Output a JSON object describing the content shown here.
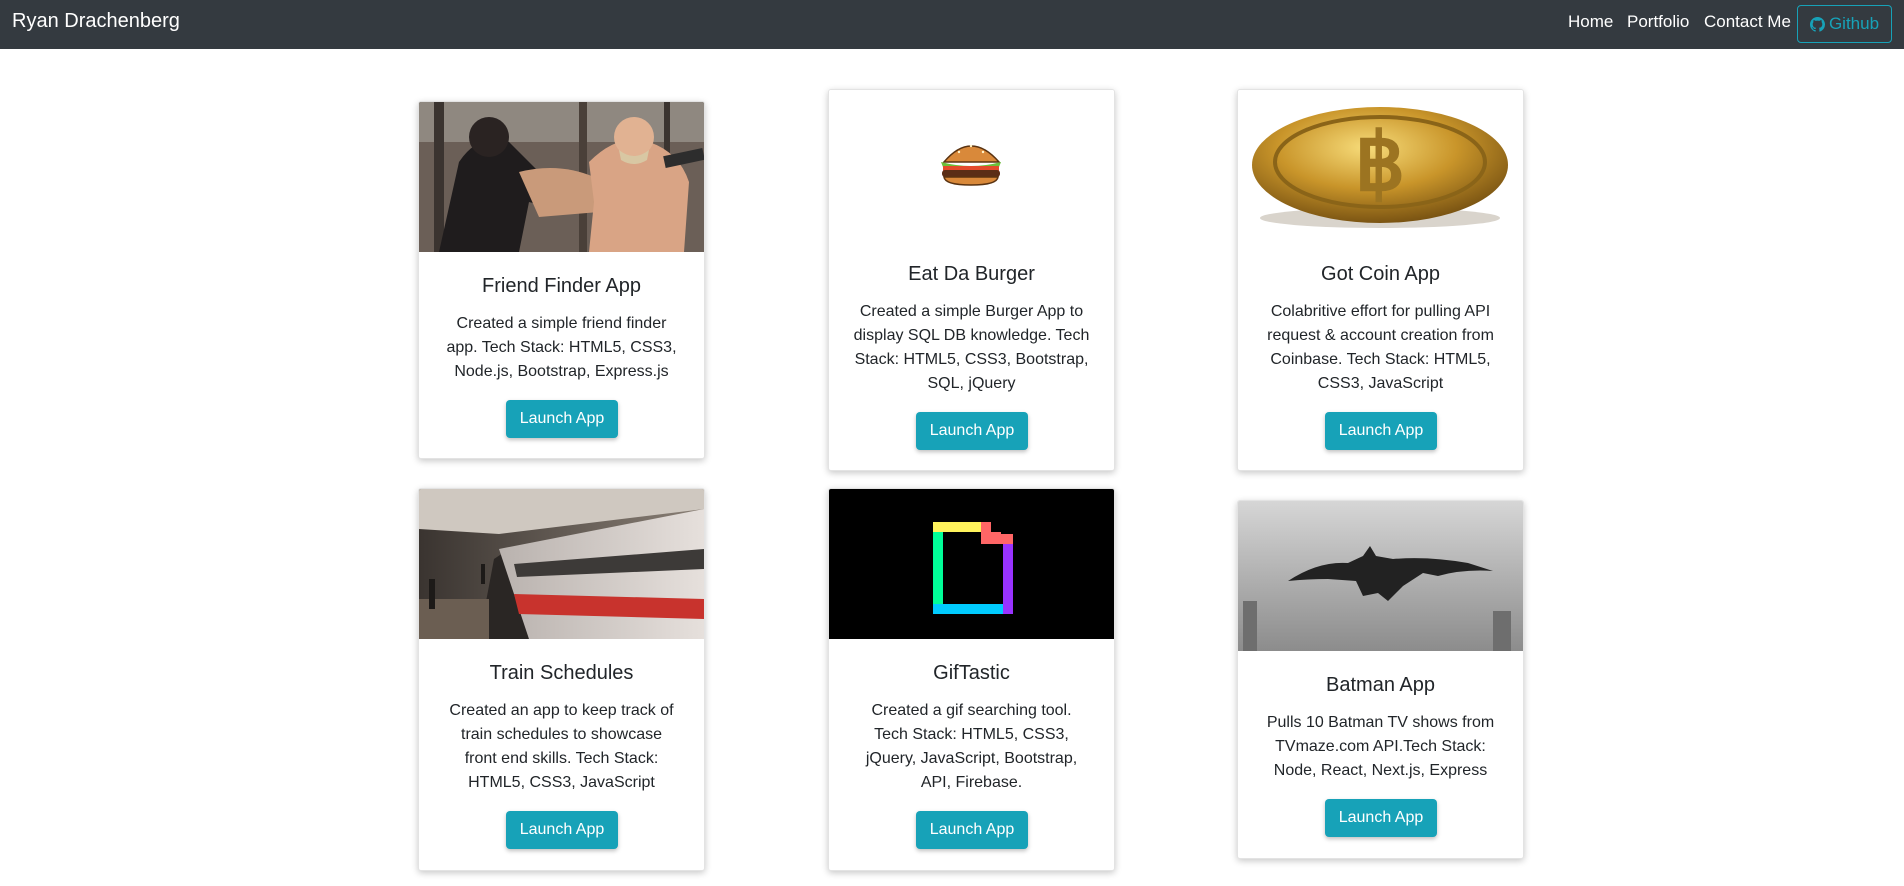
{
  "navbar": {
    "brand": "Ryan Drachenberg",
    "links": [
      "Home",
      "Portfolio",
      "Contact Me"
    ],
    "github_label": "Github"
  },
  "colors": {
    "navbar_bg": "#343a40",
    "accent": "#17a2b8"
  },
  "cards": [
    {
      "title": "Friend Finder App",
      "description": "Created a simple friend finder app. Tech Stack: HTML5, CSS3, Node.js, Bootstrap, Express.js",
      "button": "Launch App",
      "image": "anime-fighters-image"
    },
    {
      "title": "Eat Da Burger",
      "description": "Created a simple Burger App to display SQL DB knowledge. Tech Stack: HTML5, CSS3, Bootstrap, SQL, jQuery",
      "button": "Launch App",
      "image": "burger-image"
    },
    {
      "title": "Got Coin App",
      "description": "Colabritive effort for pulling API request & account creation from Coinbase. Tech Stack: HTML5, CSS3, JavaScript",
      "button": "Launch App",
      "image": "bitcoin-image"
    },
    {
      "title": "Train Schedules",
      "description": "Created an app to keep track of train schedules to showcase front end skills. Tech Stack: HTML5, CSS3, JavaScript",
      "button": "Launch App",
      "image": "subway-train-image"
    },
    {
      "title": "GifTastic",
      "description": "Created a gif searching tool. Tech Stack: HTML5, CSS3, jQuery, JavaScript, Bootstrap, API, Firebase.",
      "button": "Launch App",
      "image": "giphy-logo-image"
    },
    {
      "title": "Batman App",
      "description": "Pulls 10 Batman TV shows from TVmaze.com API.Tech Stack: Node, React, Next.js, Express",
      "button": "Launch App",
      "image": "bat-silhouette-image"
    }
  ]
}
